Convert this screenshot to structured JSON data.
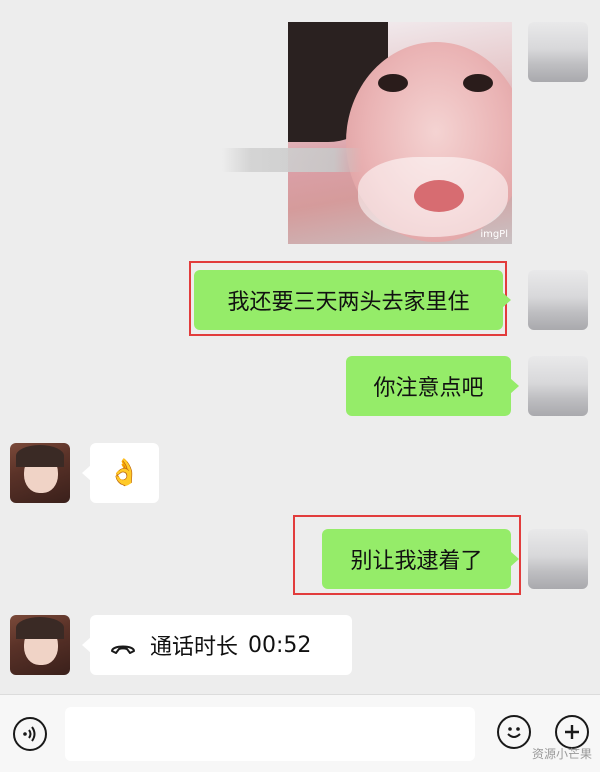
{
  "messages": {
    "photo_watermark": "imgPl",
    "m1": "我还要三天两头去家里住",
    "m2": "你注意点吧",
    "m3_emoji": "👌",
    "m4": "别让我逮着了",
    "call_label": "通话时长",
    "call_duration": "00:52"
  },
  "input": {
    "placeholder": ""
  },
  "watermark": "资源小芒果",
  "icons": {
    "voice": "voice-icon",
    "emoji": "emoji-icon",
    "plus": "plus-icon",
    "call": "phone-icon"
  },
  "colors": {
    "background": "#ededed",
    "outgoing_bubble": "#95ec69",
    "incoming_bubble": "#ffffff",
    "highlight_box": "#e23c3c"
  }
}
